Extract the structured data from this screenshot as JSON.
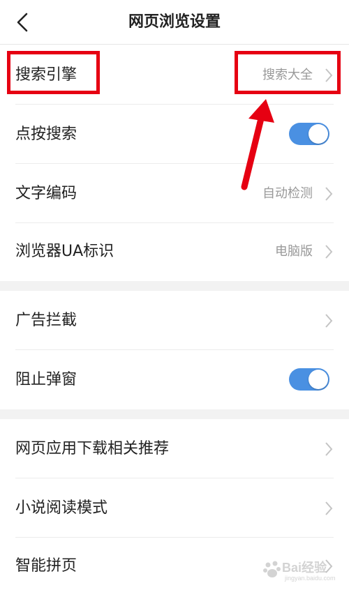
{
  "header": {
    "title": "网页浏览设置",
    "back_icon": "chevron-left-icon"
  },
  "section1": {
    "items": [
      {
        "label": "搜索引擎",
        "value": "搜索大全"
      },
      {
        "label": "点按搜索",
        "toggle": true
      },
      {
        "label": "文字编码",
        "value": "自动检测"
      },
      {
        "label": "浏览器UA标识",
        "value": "电脑版"
      }
    ]
  },
  "section2": {
    "items": [
      {
        "label": "广告拦截"
      },
      {
        "label": "阻止弹窗",
        "toggle": true
      }
    ]
  },
  "section3": {
    "items": [
      {
        "label": "网页应用下载相关推荐"
      },
      {
        "label": "小说阅读模式"
      },
      {
        "label": "智能拼页"
      }
    ]
  },
  "colors": {
    "toggle_on": "#4a90e2",
    "annotation": "#e60012",
    "value_text": "#999999"
  },
  "watermark": {
    "logo": "Bai经验",
    "url": "jingyan.baidu.com"
  }
}
